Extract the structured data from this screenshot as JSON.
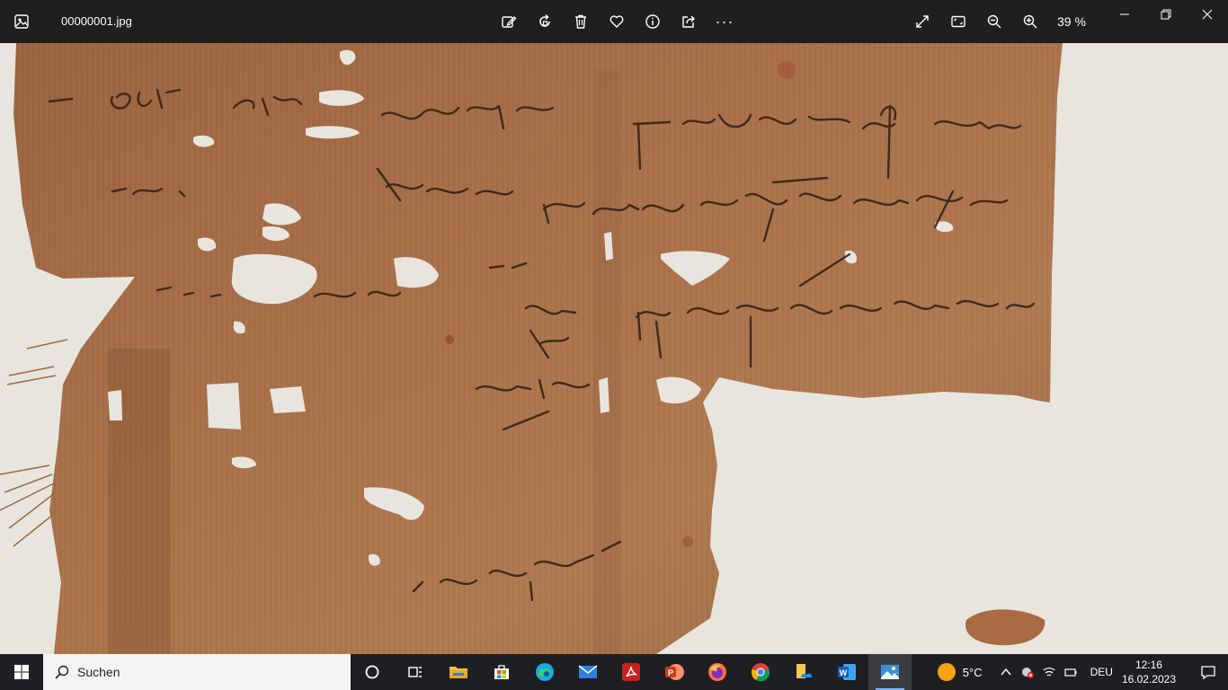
{
  "window": {
    "file_name": "00000001.jpg",
    "zoom_level": "39 %"
  },
  "toolbar": {
    "edit_icon": "edit-image-icon",
    "rotate_icon": "rotate-icon",
    "delete_icon": "trash-icon",
    "favorite_icon": "heart-icon",
    "info_icon": "info-icon",
    "share_icon": "share-icon",
    "more_label": "···"
  },
  "taskbar": {
    "search_label": "Suchen",
    "weather_temp": "5°C",
    "language": "DEU",
    "time": "12:16",
    "date": "16.02.2023",
    "apps": [
      {
        "name": "cortana",
        "color": "#ffffff"
      },
      {
        "name": "task-view",
        "color": "#ffffff"
      },
      {
        "name": "file-explorer",
        "color": "#f6c343"
      },
      {
        "name": "microsoft-store",
        "color": "#2b88d8"
      },
      {
        "name": "edge",
        "color": "#1fa8e0"
      },
      {
        "name": "mail",
        "color": "#2f7ee0"
      },
      {
        "name": "acrobat",
        "color": "#d8291b"
      },
      {
        "name": "powerpoint",
        "color": "#d24726"
      },
      {
        "name": "firefox",
        "color": "#ff7139"
      },
      {
        "name": "chrome",
        "color": "#4285f4"
      },
      {
        "name": "files-cloud",
        "color": "#f7c948"
      },
      {
        "name": "word",
        "color": "#2b579a"
      },
      {
        "name": "photos",
        "color": "#3c8fd6"
      }
    ]
  },
  "colors": {
    "titlebar": "#1f1f1f",
    "taskbar": "#1e1f22",
    "papyrus": "#a9714a",
    "background_paper": "#e8e5de"
  }
}
